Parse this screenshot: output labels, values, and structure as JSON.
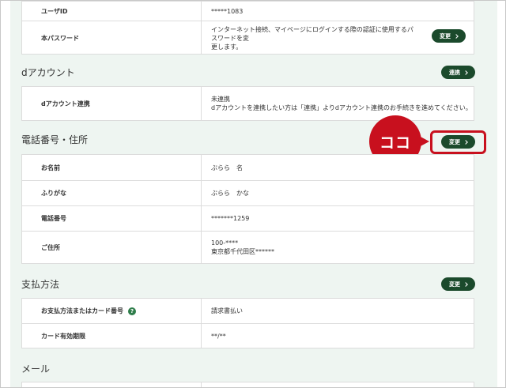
{
  "top_table": {
    "rows": [
      {
        "label": "ユーザID",
        "value": "*****1083"
      },
      {
        "label": "本パスワード",
        "value_line1": "インターネット接続、マイページにログインする際の認証に使用するパスワードを変",
        "value_line2": "更します。",
        "button": "変更"
      }
    ]
  },
  "d_account": {
    "title": "dアカウント",
    "button": "連携",
    "row_label": "dアカウント連携",
    "status": "未連携",
    "note": "dアカウントを連携したい方は「連携」よりdアカウント連携のお手続きを進めてください。"
  },
  "phone_address": {
    "title": "電話番号・住所",
    "button": "変更",
    "rows": [
      {
        "label": "お名前",
        "value": "ぶらら　名"
      },
      {
        "label": "ふりがな",
        "value": "ぶらら　かな"
      },
      {
        "label": "電話番号",
        "value": "*******1259"
      },
      {
        "label": "ご住所",
        "value_line1": "100-****",
        "value_line2": "東京都千代田区******"
      }
    ]
  },
  "payment": {
    "title": "支払方法",
    "button": "変更",
    "rows": [
      {
        "label": "お支払方法またはカード番号",
        "value": "請求書払い"
      },
      {
        "label": "カード有効期限",
        "value": "**/**"
      }
    ]
  },
  "mail": {
    "title": "メール"
  },
  "callout": {
    "text": "ココ",
    "color": "#c8101e"
  },
  "colors": {
    "button_bg": "#1b4a2c",
    "page_bg": "#eef5f1",
    "help_icon": "#2e7d4a"
  }
}
